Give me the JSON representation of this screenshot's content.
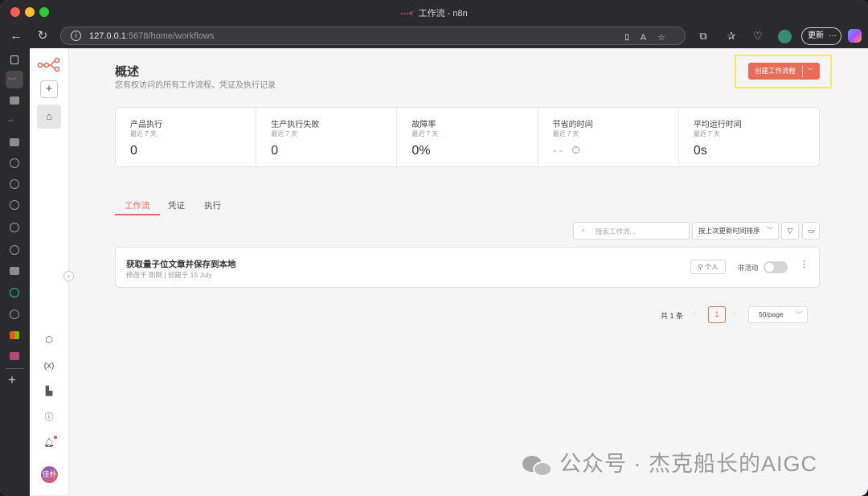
{
  "browser": {
    "window_title": "工作流 - n8n",
    "title_icon": "n8n-logo-icon",
    "url_host": "127.0.0.1",
    "url_rest": ":5678/home/workflows",
    "update_label": "更新",
    "update_more": "···"
  },
  "sidebar": {
    "user_initials": "佳朴",
    "icons": [
      "plus-icon",
      "home-icon",
      "templates-icon",
      "variables-icon",
      "insights-icon",
      "help-icon",
      "bell-icon"
    ]
  },
  "header": {
    "title": "概述",
    "subtitle": "您有权访问的所有工作流程、凭证及执行记录",
    "create_label": "创建工作流程",
    "create_chevron": "﹀"
  },
  "stats": [
    {
      "label": "产品执行",
      "period": "最近 7 天",
      "value": "0"
    },
    {
      "label": "生产执行失败",
      "period": "最近 7 天",
      "value": "0"
    },
    {
      "label": "故障率",
      "period": "最近 7 天",
      "value": "0%"
    },
    {
      "label": "节省的时间",
      "period": "最近 7 天",
      "value": "--"
    },
    {
      "label": "平均运行时间",
      "period": "最近 7 天",
      "value": "0s"
    }
  ],
  "tabs": [
    {
      "label": "工作流",
      "active": true
    },
    {
      "label": "凭证",
      "active": false
    },
    {
      "label": "执行",
      "active": false
    }
  ],
  "filters": {
    "search_placeholder": "搜索工作流...",
    "sort_label": "按上次更新时间排序"
  },
  "workflows": [
    {
      "name": "获取量子位文章并保存到本地",
      "meta": "修改于 刚刚 | 创建于 15 July",
      "owner": "个人",
      "status": "非活动",
      "active": false
    }
  ],
  "pagination": {
    "total": "共 1 条",
    "current_page": "1",
    "page_size": "50/page"
  },
  "watermark": "公众号 · 杰克船长的AIGC",
  "colors": {
    "accent": "#ea6b58",
    "highlight": "#f3e85a"
  }
}
